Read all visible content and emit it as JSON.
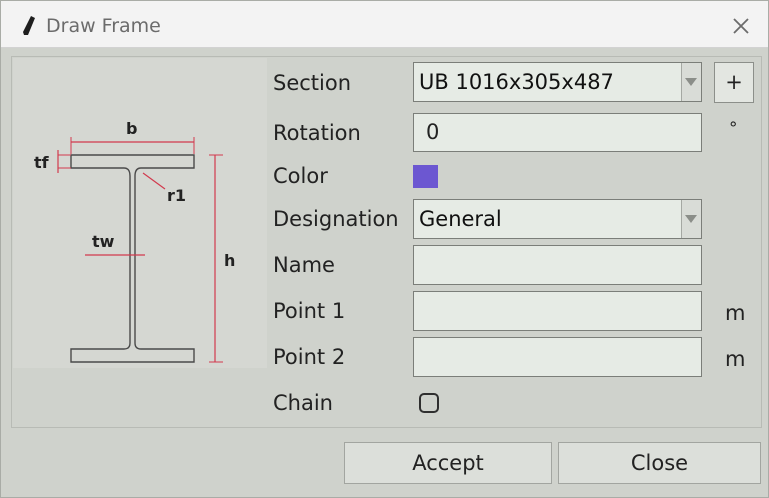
{
  "window": {
    "title": "Draw Frame"
  },
  "diagram": {
    "labels": {
      "b": "b",
      "tf": "tf",
      "r1": "r1",
      "tw": "tw",
      "h": "h"
    }
  },
  "form": {
    "section": {
      "label": "Section",
      "value": "UB 1016x305x487",
      "add_label": "+"
    },
    "rotation": {
      "label": "Rotation",
      "value": "0",
      "unit": "°"
    },
    "color": {
      "label": "Color",
      "value": "#6c57d1"
    },
    "designation": {
      "label": "Designation",
      "value": "General"
    },
    "name": {
      "label": "Name",
      "value": ""
    },
    "point1": {
      "label": "Point 1",
      "value": "",
      "unit": "m"
    },
    "point2": {
      "label": "Point 2",
      "value": "",
      "unit": "m"
    },
    "chain": {
      "label": "Chain",
      "checked": false
    }
  },
  "buttons": {
    "accept": "Accept",
    "close": "Close"
  }
}
